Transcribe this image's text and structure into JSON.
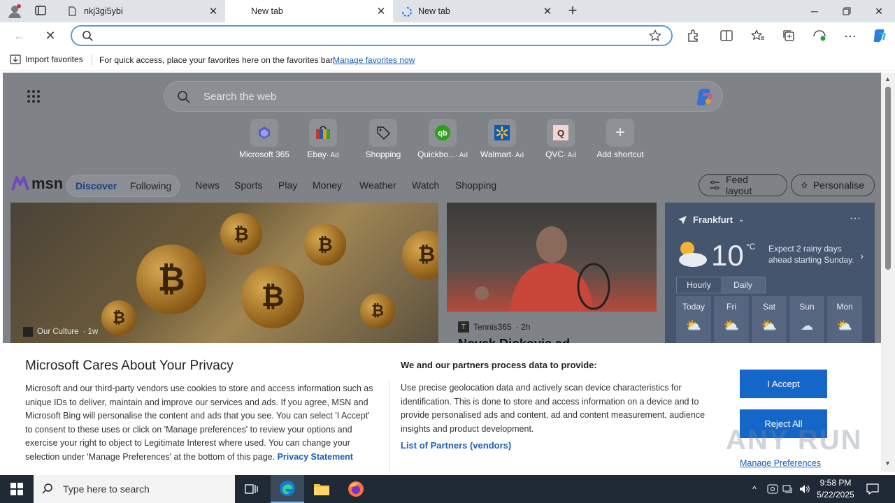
{
  "browser": {
    "tabs": [
      {
        "title": "nkj3gi5ybi",
        "active": false
      },
      {
        "title": "New tab",
        "active": true
      },
      {
        "title": "New tab",
        "active": false,
        "loading": true
      }
    ],
    "address_value": "",
    "favorites_bar": {
      "import_label": "Import favorites",
      "hint": "For quick access, place your favorites here on the favorites bar.",
      "manage_link": "Manage favorites now"
    }
  },
  "newtab": {
    "search_placeholder": "Search the web",
    "shortcuts": [
      {
        "name": "Microsoft 365",
        "ad": ""
      },
      {
        "name": "Ebay",
        "ad": "· Ad"
      },
      {
        "name": "Shopping",
        "ad": ""
      },
      {
        "name": "Quickbo...",
        "ad": "· Ad"
      },
      {
        "name": "Walmart",
        "ad": "· Ad"
      },
      {
        "name": "QVC",
        "ad": "· Ad"
      },
      {
        "name": "Add shortcut",
        "ad": ""
      }
    ],
    "feed": {
      "logo": "msn",
      "discover": "Discover",
      "following": "Following",
      "nav": [
        "News",
        "Sports",
        "Play",
        "Money",
        "Weather",
        "Watch",
        "Shopping"
      ],
      "feed_layout": "Feed layout",
      "personalise": "Personalise"
    },
    "cards": {
      "main_source": "Our Culture",
      "main_age": "· 1w",
      "second_source": "Tennis365",
      "second_age": "· 2h",
      "second_headline": "Novak Djokovic ad"
    },
    "weather": {
      "location": "Frankfurt",
      "temp": "10",
      "unit": "°C",
      "desc": "Expect 2 rainy days ahead starting Sunday.",
      "tab_hourly": "Hourly",
      "tab_daily": "Daily",
      "days": [
        "Today",
        "Fri",
        "Sat",
        "Sun",
        "Mon"
      ]
    }
  },
  "privacy": {
    "title": "Microsoft Cares About Your Privacy",
    "body": "Microsoft and our third-party vendors use cookies to store and access information such as unique IDs to deliver, maintain and improve our services and ads. If you agree, MSN and Microsoft Bing will personalise the content and ads that you see. You can select 'I Accept' to consent to these uses or click on 'Manage preferences' to review your options and exercise your right to object to Legitimate Interest where used.  You can change your selection under 'Manage Preferences' at the bottom of this page.",
    "privacy_link": "Privacy Statement",
    "purposes_title": "We and our partners process data to provide:",
    "purposes": "Use precise geolocation data and actively scan device characteristics for identification. This is done to store and access information on a device and to provide personalised ads and content, ad and content measurement, audience insights and product development.",
    "partners_link": "List of Partners (vendors)",
    "accept": "I Accept",
    "reject": "Reject All",
    "manage": "Manage Preferences"
  },
  "watermark": "ANY RUN",
  "taskbar": {
    "search_placeholder": "Type here to search",
    "time": "9:58 PM",
    "date": "5/22/2025"
  }
}
